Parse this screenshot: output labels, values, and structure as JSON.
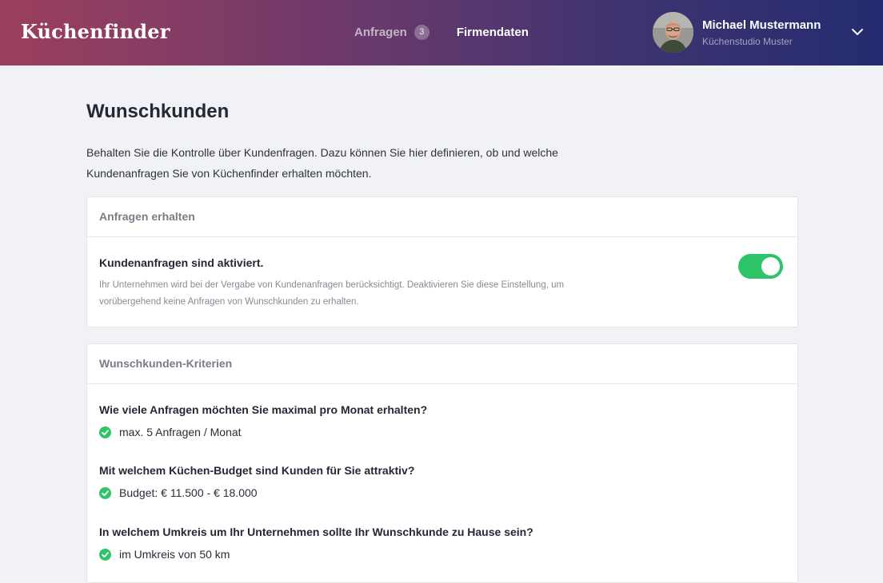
{
  "header": {
    "logo": "Küchenfinder",
    "nav": [
      {
        "label": "Anfragen",
        "badge": "3"
      },
      {
        "label": "Firmendaten"
      }
    ],
    "user": {
      "name": "Michael Mustermann",
      "company": "Küchenstudio Muster"
    }
  },
  "page": {
    "title": "Wunschkunden",
    "intro": "Behalten Sie die Kontrolle über Kundenfragen. Dazu können Sie hier definieren, ob und welche Kundenanfragen Sie von Küchenfinder erhalten möchten."
  },
  "requests_card": {
    "header": "Anfragen erhalten",
    "setting_title": "Kundenanfragen sind aktiviert.",
    "setting_desc": "Ihr Unternehmen wird bei der Vergabe von Kundenanfragen berücksichtigt. Deaktivieren Sie diese Einstellung, um vorübergehend keine Anfragen von Wunschkunden zu erhalten.",
    "enabled": true
  },
  "criteria_card": {
    "header": "Wunschkunden-Kriterien",
    "items": [
      {
        "question": "Wie viele Anfragen möchten Sie maximal pro Monat erhalten?",
        "answer": "max. 5 Anfragen / Monat"
      },
      {
        "question": "Mit welchem Küchen-Budget sind Kunden für Sie attraktiv?",
        "answer": "Budget: € 11.500 - € 18.000"
      },
      {
        "question": "In welchem Umkreis um Ihr Unternehmen sollte Ihr Wunschkunde zu Hause sein?",
        "answer": "im Umkreis von 50 km"
      }
    ]
  },
  "colors": {
    "accent_green": "#2ec46a",
    "header_gradient_start": "#9c3f5d",
    "header_gradient_end": "#242c6f"
  },
  "icons": {
    "check": "check-circle-icon",
    "chevron": "chevron-down-icon"
  }
}
